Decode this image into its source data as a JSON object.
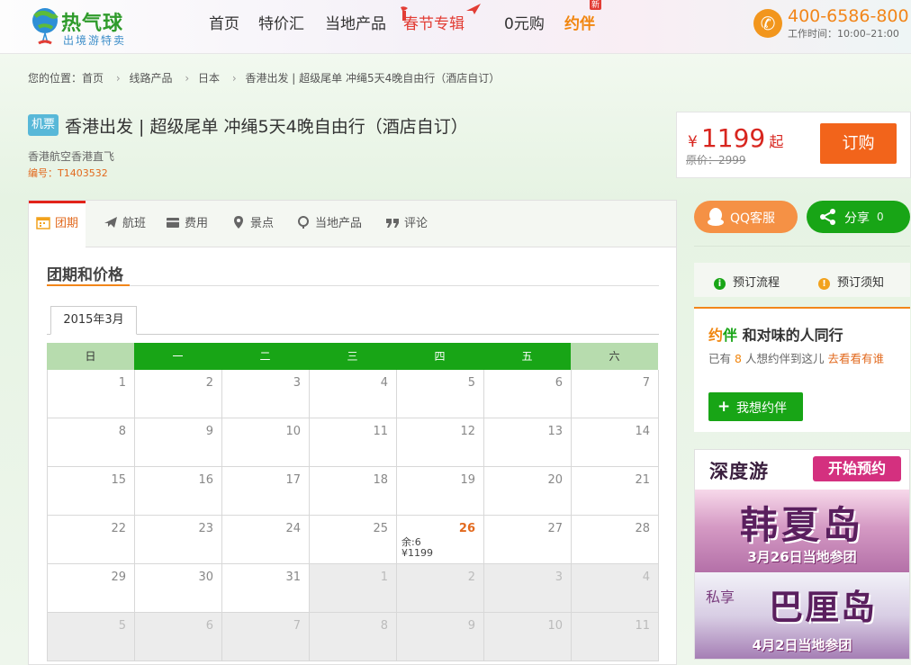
{
  "header": {
    "logo_name": "热气球",
    "logo_slogan": "出境游特卖",
    "nav": [
      {
        "label": "首页"
      },
      {
        "label": "特价汇"
      },
      {
        "label": "当地产品"
      },
      {
        "label": "春节专辑"
      },
      {
        "label": "0元购"
      },
      {
        "label": "约伴"
      }
    ],
    "new_badge": "新",
    "phone": "400-6586-800",
    "work_hours": "工作时间：10:00–21:00"
  },
  "breadcrumb": {
    "prefix": "您的位置：",
    "items": [
      "首页",
      "线路产品",
      "日本",
      "香港出发 | 超级尾单 冲绳5天4晚自由行（酒店自订）"
    ]
  },
  "product": {
    "tag": "机票",
    "title": "香港出发 | 超级尾单 冲绳5天4晚自由行（酒店自订）",
    "airline": "香港航空香港直飞",
    "code_label": "编号：",
    "code": "T1403532"
  },
  "price": {
    "currency": "¥",
    "amount": "1199",
    "suffix": "起",
    "original_label": "原价：",
    "original": "2999",
    "order_label": "订购"
  },
  "tabs": [
    {
      "label": "团期",
      "icon": "calendar-icon"
    },
    {
      "label": "航班",
      "icon": "plane-icon"
    },
    {
      "label": "费用",
      "icon": "wallet-icon"
    },
    {
      "label": "景点",
      "icon": "map-pin-icon"
    },
    {
      "label": "当地产品",
      "icon": "location-icon"
    },
    {
      "label": "评论",
      "icon": "quote-icon"
    }
  ],
  "schedule": {
    "section_title": "团期和价格",
    "month": "2015年3月",
    "weekdays": [
      "日",
      "一",
      "二",
      "三",
      "四",
      "五",
      "六"
    ],
    "rows": [
      [
        {
          "d": "1"
        },
        {
          "d": "2"
        },
        {
          "d": "3"
        },
        {
          "d": "4"
        },
        {
          "d": "5"
        },
        {
          "d": "6"
        },
        {
          "d": "7"
        }
      ],
      [
        {
          "d": "8"
        },
        {
          "d": "9"
        },
        {
          "d": "10"
        },
        {
          "d": "11"
        },
        {
          "d": "12"
        },
        {
          "d": "13"
        },
        {
          "d": "14"
        }
      ],
      [
        {
          "d": "15"
        },
        {
          "d": "16"
        },
        {
          "d": "17"
        },
        {
          "d": "18"
        },
        {
          "d": "19"
        },
        {
          "d": "20"
        },
        {
          "d": "21"
        }
      ],
      [
        {
          "d": "22"
        },
        {
          "d": "23"
        },
        {
          "d": "24"
        },
        {
          "d": "25"
        },
        {
          "d": "26",
          "avail": true,
          "remain": "余:6",
          "price": "¥1199"
        },
        {
          "d": "27"
        },
        {
          "d": "28"
        }
      ],
      [
        {
          "d": "29"
        },
        {
          "d": "30"
        },
        {
          "d": "31"
        },
        {
          "d": "1",
          "other": true
        },
        {
          "d": "2",
          "other": true
        },
        {
          "d": "3",
          "other": true
        },
        {
          "d": "4",
          "other": true
        }
      ],
      [
        {
          "d": "5",
          "other": true
        },
        {
          "d": "6",
          "other": true
        },
        {
          "d": "7",
          "other": true
        },
        {
          "d": "8",
          "other": true
        },
        {
          "d": "9",
          "other": true
        },
        {
          "d": "10",
          "other": true
        },
        {
          "d": "11",
          "other": true
        }
      ]
    ]
  },
  "sidebar": {
    "qq_label": "QQ客服",
    "share_label": "分享",
    "share_count": "0",
    "booking_flow": "预订流程",
    "booking_notice": "预订须知",
    "yueban": {
      "title_1": "约",
      "title_2": "伴",
      "title_rest": "和对味的人同行",
      "desc_pre": "已有",
      "count": "8",
      "desc_mid": "人想约伴到这儿",
      "link": "去看看有谁",
      "btn_label": "我想约伴"
    }
  },
  "promo": {
    "brand": "深度游",
    "start_label": "开始预约",
    "big1": "韩夏岛",
    "date1": "3月26日当地参团",
    "siheng": "私享",
    "big2": "巴厘岛",
    "date2": "4月2日当地参团"
  },
  "colors": {
    "brand_green": "#18a516",
    "accent_orange": "#f2641b",
    "price_red": "#d8261f"
  }
}
